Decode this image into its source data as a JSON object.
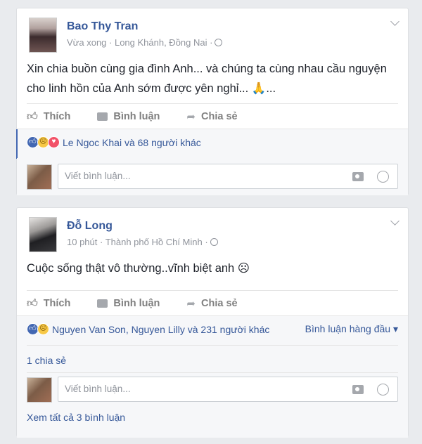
{
  "posts": [
    {
      "author": "Bao Thy Tran",
      "meta": "Vừa xong · Long Khánh, Đồng Nai ·",
      "text_line1": "Xin chia buồn cùng gia đình Anh... và chúng ta cùng nhau cầu nguyện",
      "text_line2": "cho linh hồn của Anh sớm được yên nghỉ... 🙏...",
      "reactions_text": "Le Ngoc Khai và 68 người khác",
      "reaction_icons": [
        "like-icon",
        "sad-icon",
        "love-icon"
      ]
    },
    {
      "author": "Đỗ Long",
      "meta": "10 phút · Thành phố Hồ Chí Minh ·",
      "text_line1": "Cuộc sống thật vô thường..vĩnh biệt anh ☹",
      "reactions_text": "Nguyen Van Son, Nguyen Lilly và 231 người khác",
      "reaction_icons": [
        "like-icon",
        "sad-icon"
      ],
      "top_comments_label": "Bình luận hàng đầu ▾",
      "share_count": "1 chia sẻ",
      "see_all": "Xem tất cả 3 bình luận"
    }
  ],
  "actions": {
    "like": "Thích",
    "comment": "Bình luận",
    "share": "Chia sẻ"
  },
  "comment_placeholder": "Viết bình luận...",
  "colors": {
    "link": "#365899",
    "background": "#e9ebee",
    "like_blue": "#4267b2",
    "love_red": "#f25268",
    "sad_yellow": "#f7c846"
  }
}
